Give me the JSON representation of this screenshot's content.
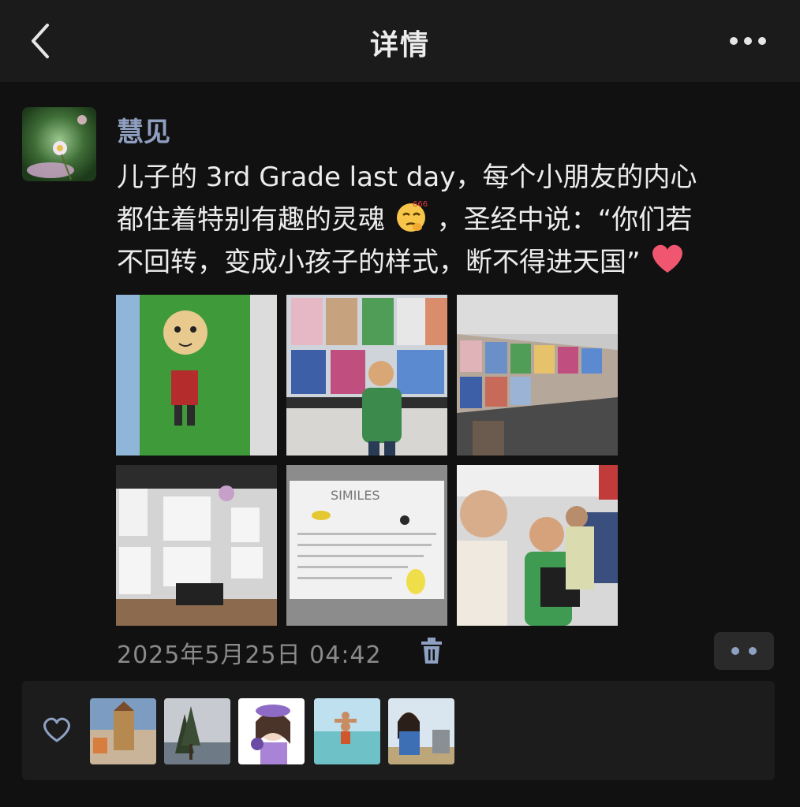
{
  "header": {
    "title": "详情",
    "back_icon": "chevron-left-icon",
    "more_icon": "more-horizontal-icon"
  },
  "post": {
    "author": "慧见",
    "text_lines": [
      "儿子的 3rd Grade last day，每个小朋友的内心",
      "都住着特别有趣的灵魂",
      "，圣经中说：“你们若",
      "不回转，变成小孩子的样式，断不得进天国”"
    ],
    "emoji_1": "thinking-face-666-emoji",
    "emoji_2": "red-heart-emoji",
    "photo_count": 6,
    "timestamp": "2025年5月25日 04:42",
    "trash_icon": "trash-icon",
    "action_icon": "two-dots-icon"
  },
  "likes": {
    "icon": "heart-outline-icon",
    "liker_count": 5
  },
  "colors": {
    "background": "#111111",
    "header_bg": "#1b1b1b",
    "username": "#8e9fbf",
    "body_text": "#ececec",
    "timestamp": "#8a8a8a",
    "panel_bg": "#1c1c1c"
  }
}
